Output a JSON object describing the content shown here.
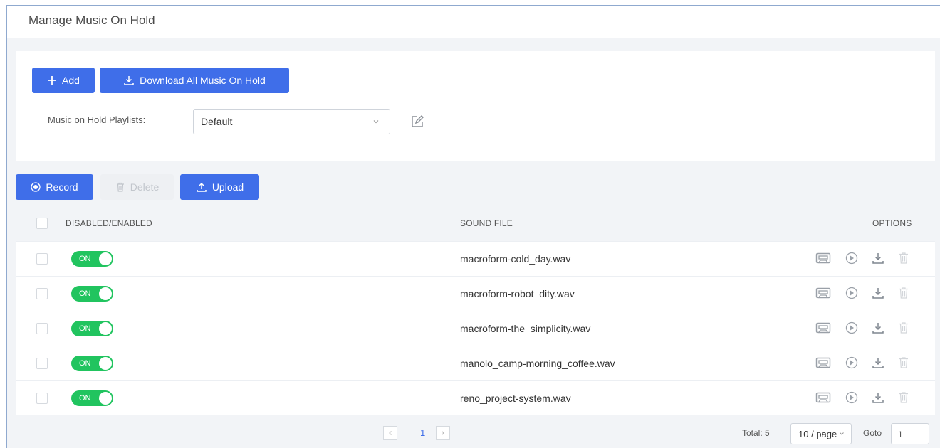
{
  "page": {
    "title": "Manage Music On Hold"
  },
  "top_actions": {
    "add_label": "Add",
    "download_all_label": "Download All Music On Hold"
  },
  "playlist": {
    "label": "Music on Hold Playlists:",
    "selected": "Default"
  },
  "toolbar": {
    "record_label": "Record",
    "delete_label": "Delete",
    "upload_label": "Upload"
  },
  "table": {
    "columns": {
      "enabled": "DISABLED/ENABLED",
      "sound_file": "SOUND FILE",
      "options": "OPTIONS"
    },
    "rows": [
      {
        "enabled": "ON",
        "file": "macroform-cold_day.wav"
      },
      {
        "enabled": "ON",
        "file": "macroform-robot_dity.wav"
      },
      {
        "enabled": "ON",
        "file": "macroform-the_simplicity.wav"
      },
      {
        "enabled": "ON",
        "file": "manolo_camp-morning_coffee.wav"
      },
      {
        "enabled": "ON",
        "file": "reno_project-system.wav"
      }
    ]
  },
  "pagination": {
    "current_page": "1",
    "total": "Total: 5",
    "per_page": "10 / page",
    "goto_label": "Goto",
    "goto_value": "1"
  },
  "colors": {
    "primary": "#3f6ee9",
    "toggle_on": "#21c45f",
    "border": "#8fa9cf"
  }
}
